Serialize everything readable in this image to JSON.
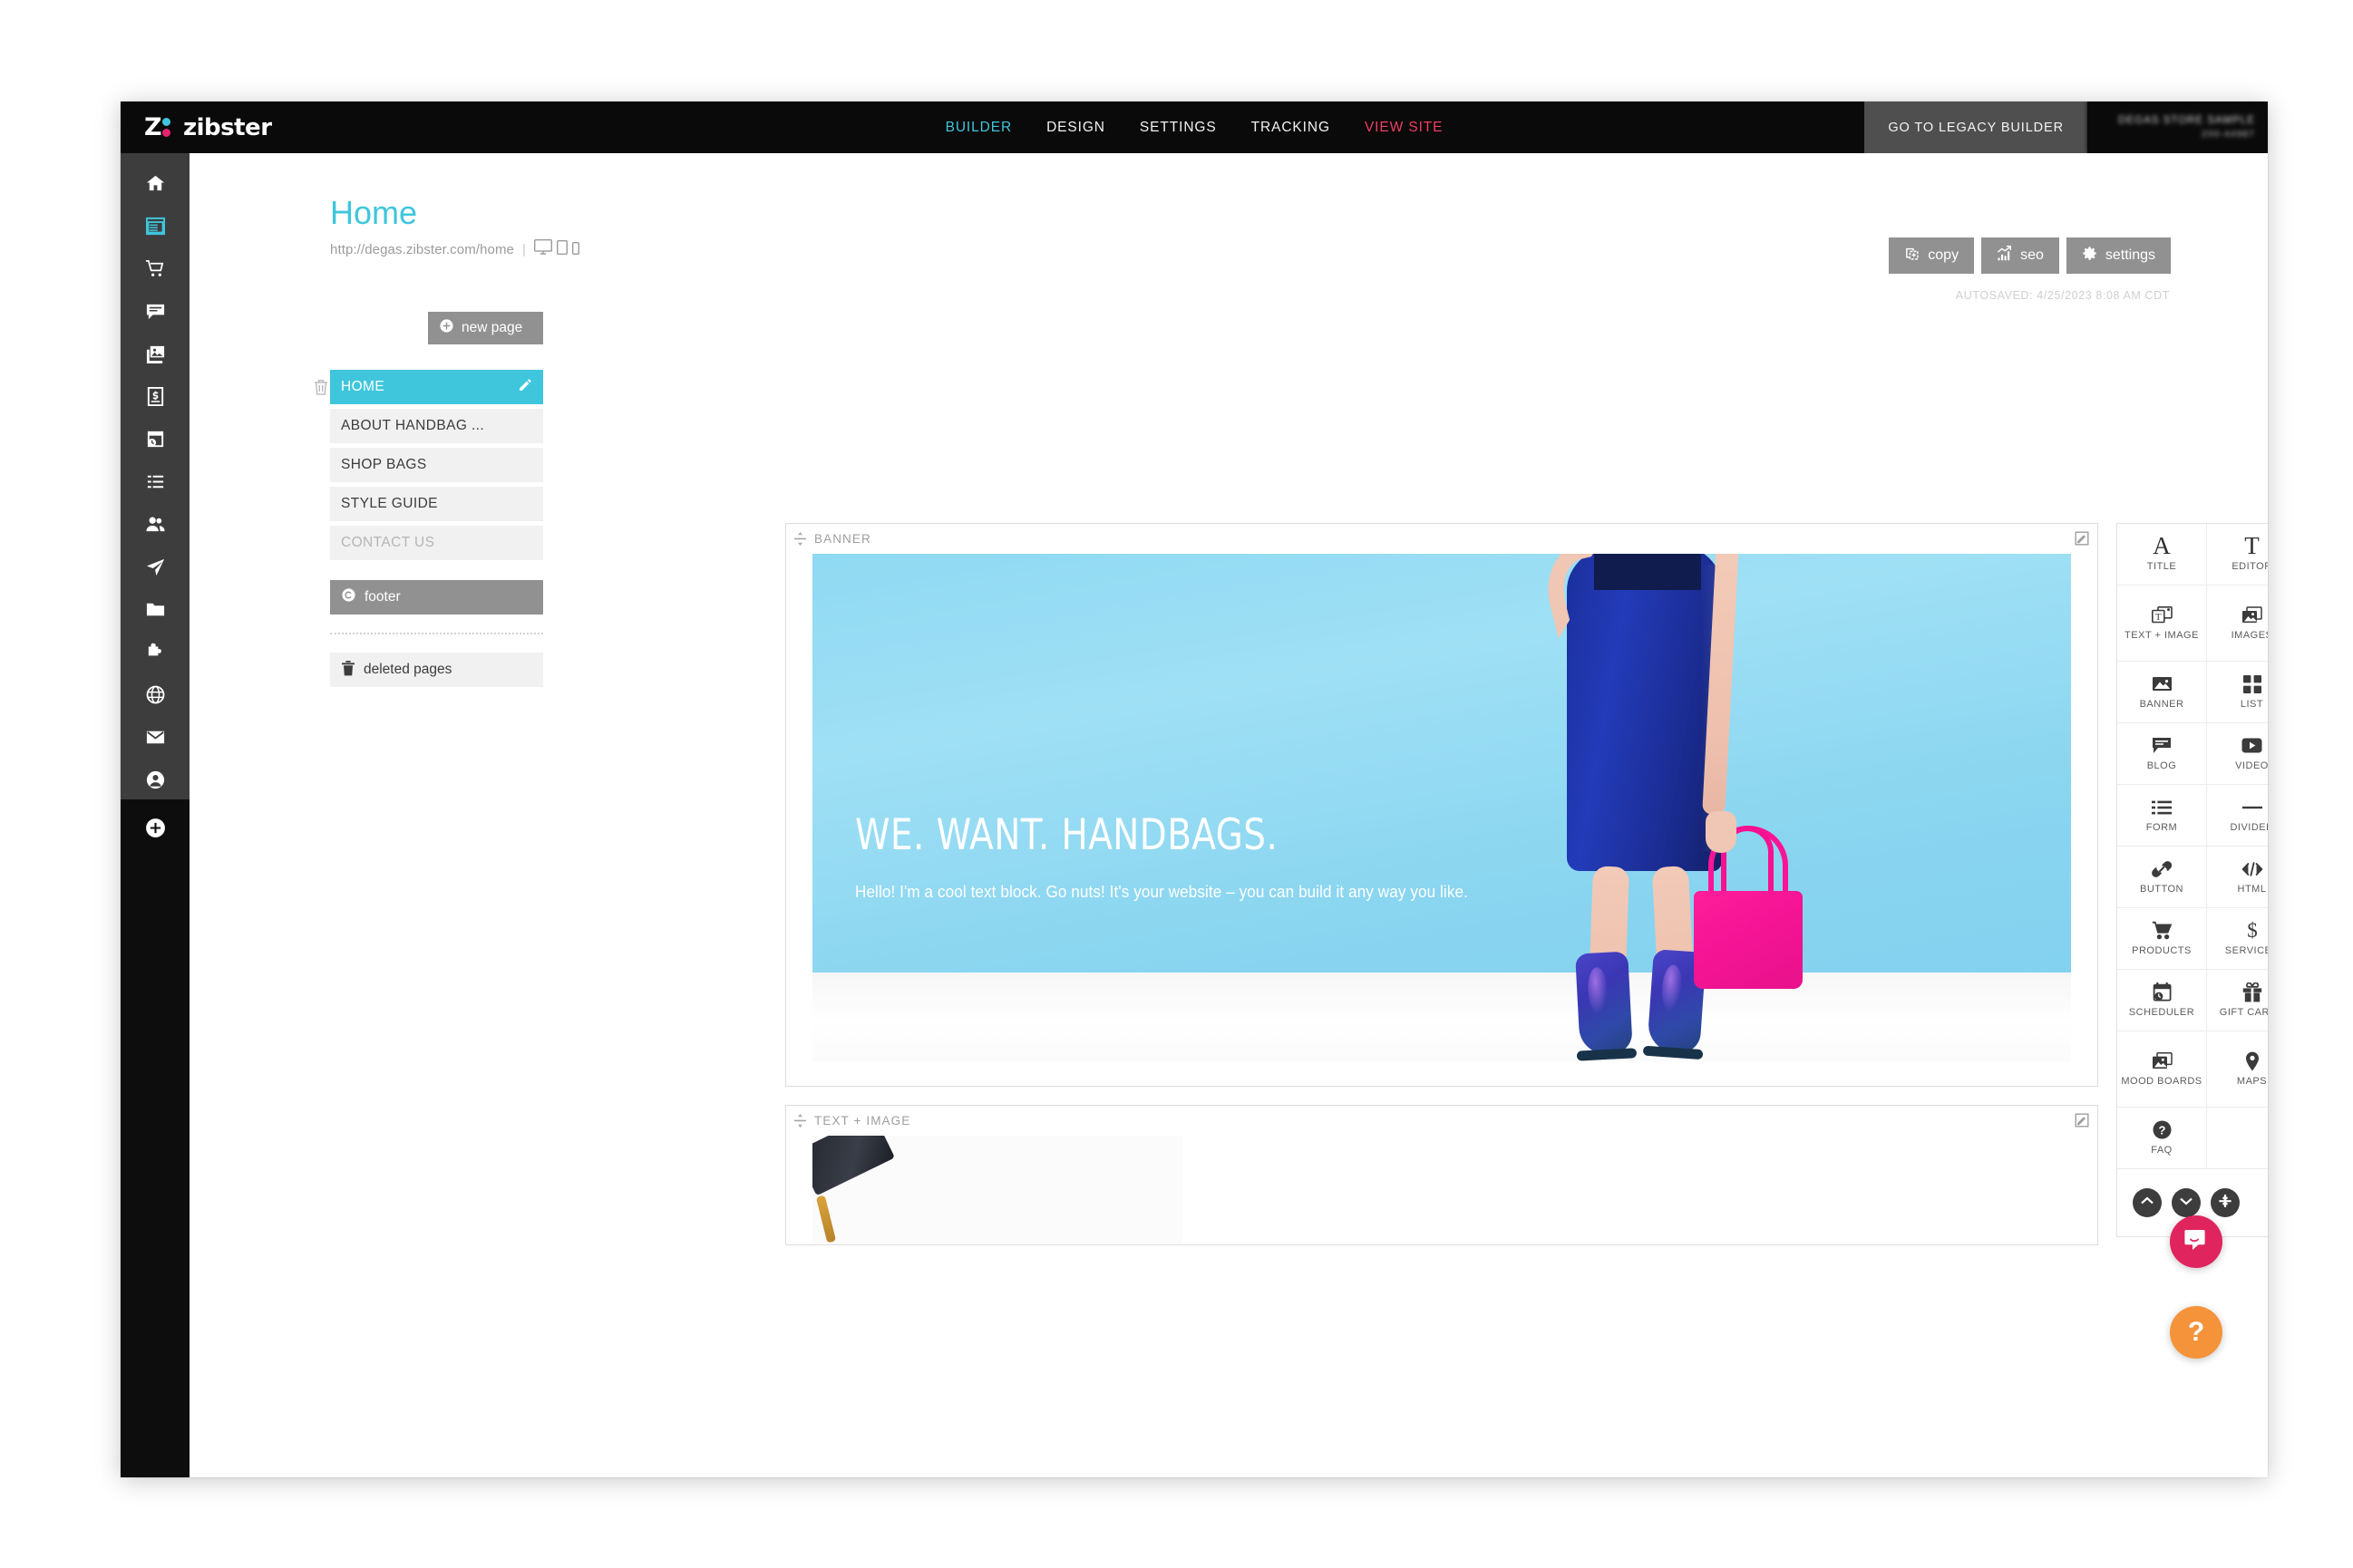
{
  "topbar": {
    "brand": {
      "letter": "Z",
      "word": "zibster"
    },
    "nav": [
      {
        "label": "BUILDER",
        "state": "active"
      },
      {
        "label": "DESIGN",
        "state": "normal"
      },
      {
        "label": "SETTINGS",
        "state": "normal"
      },
      {
        "label": "TRACKING",
        "state": "normal"
      },
      {
        "label": "VIEW SITE",
        "state": "view"
      }
    ],
    "legacy_button": "GO TO LEGACY BUILDER",
    "account_name": "DEGAS STORE SAMPLE",
    "account_phone": "200-44987"
  },
  "rail": {
    "items": [
      {
        "name": "home-icon",
        "active": false
      },
      {
        "name": "website-icon",
        "active": true
      },
      {
        "name": "store-cart-icon",
        "active": false
      },
      {
        "name": "blog-icon",
        "active": false
      },
      {
        "name": "gallery-icon",
        "active": false
      },
      {
        "name": "invoice-icon",
        "active": false
      },
      {
        "name": "scheduler-icon",
        "active": false
      },
      {
        "name": "forms-icon",
        "active": false
      },
      {
        "name": "clients-icon",
        "active": false
      },
      {
        "name": "send-icon",
        "active": false
      },
      {
        "name": "folder-icon",
        "active": false
      },
      {
        "name": "integrations-icon",
        "active": false
      },
      {
        "name": "globe-icon",
        "active": false
      },
      {
        "name": "mail-icon",
        "active": false
      },
      {
        "name": "account-icon",
        "active": false
      }
    ],
    "add_label": "add"
  },
  "page": {
    "title": "Home",
    "url": "http://degas.zibster.com/home",
    "separator": "|",
    "autosaved": "AUTOSAVED: 4/25/2023 8:08 AM CDT",
    "device_previews": [
      "desktop",
      "tablet",
      "mobile"
    ]
  },
  "actions": [
    {
      "label": "copy",
      "icon": "copy-icon"
    },
    {
      "label": "seo",
      "icon": "seo-chart-icon"
    },
    {
      "label": "settings",
      "icon": "gear-icon"
    }
  ],
  "pages_panel": {
    "new_page_label": "new page",
    "items": [
      {
        "label": "HOME",
        "state": "active"
      },
      {
        "label": "ABOUT HANDBAG ...",
        "state": "normal"
      },
      {
        "label": "SHOP BAGS",
        "state": "normal"
      },
      {
        "label": "STYLE GUIDE",
        "state": "normal"
      },
      {
        "label": "CONTACT US",
        "state": "dim"
      }
    ],
    "footer_label": "footer",
    "deleted_label": "deleted pages"
  },
  "canvas": {
    "blocks": [
      {
        "type": "BANNER",
        "label": "BANNER",
        "headline": "WE. WANT. HANDBAGS.",
        "body": "Hello! I'm a cool text block. Go nuts! It's your website – you can build it any way you like."
      },
      {
        "type": "TEXT_IMAGE",
        "label": "TEXT + IMAGE"
      }
    ]
  },
  "palette": {
    "items": [
      {
        "label": "TITLE",
        "icon": "title-serif-a-icon"
      },
      {
        "label": "EDITOR",
        "icon": "editor-serif-t-icon"
      },
      {
        "label": "TEXT + IMAGE",
        "icon": "text-image-icon"
      },
      {
        "label": "IMAGES",
        "icon": "images-icon"
      },
      {
        "label": "BANNER",
        "icon": "banner-image-icon"
      },
      {
        "label": "LIST",
        "icon": "list-grid-icon"
      },
      {
        "label": "BLOG",
        "icon": "blog-bubble-icon"
      },
      {
        "label": "VIDEO",
        "icon": "video-play-icon"
      },
      {
        "label": "FORM",
        "icon": "form-lines-icon"
      },
      {
        "label": "DIVIDER",
        "icon": "divider-line-icon"
      },
      {
        "label": "BUTTON",
        "icon": "link-chain-icon"
      },
      {
        "label": "HTML",
        "icon": "code-brackets-icon"
      },
      {
        "label": "PRODUCTS",
        "icon": "shopping-cart-icon"
      },
      {
        "label": "SERVICES",
        "icon": "dollar-sign-icon"
      },
      {
        "label": "SCHEDULER",
        "icon": "calendar-clock-icon"
      },
      {
        "label": "GIFT CARDS",
        "icon": "gift-box-icon"
      },
      {
        "label": "MOOD BOARDS",
        "icon": "mood-boards-icon"
      },
      {
        "label": "MAPS",
        "icon": "map-pin-icon"
      },
      {
        "label": "FAQ",
        "icon": "question-circle-icon"
      }
    ],
    "controls": [
      {
        "name": "scroll-up-button",
        "icon": "chevron-up-icon"
      },
      {
        "name": "scroll-down-button",
        "icon": "chevron-down-icon"
      },
      {
        "name": "collapse-button",
        "icon": "collapse-icon"
      }
    ]
  },
  "fabs": [
    {
      "name": "intercom-chat-button",
      "icon": "chat-bubble-icon",
      "color": "#e0245e"
    },
    {
      "name": "help-button",
      "icon": "question-mark-icon",
      "color": "#f5933a",
      "glyph": "?"
    }
  ],
  "colors": {
    "accent_cyan": "#3fc6dc",
    "view_site_red": "#ef3e62",
    "brand_pink": "#e8236e",
    "rail_dark": "#3d3d3d",
    "topbar_black": "#0a0a0a",
    "button_grey": "#919191"
  }
}
